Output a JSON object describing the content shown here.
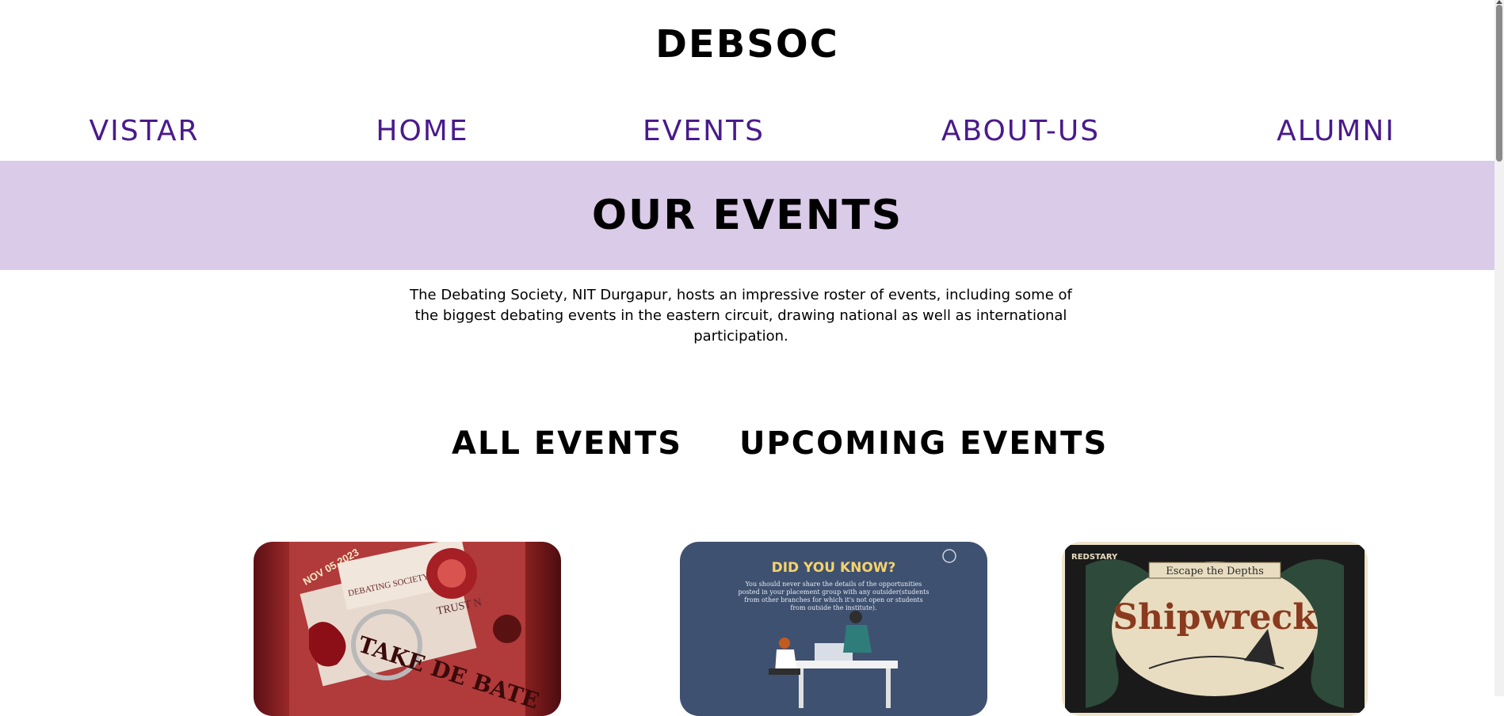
{
  "site": {
    "logo": "DEBSOC"
  },
  "nav": {
    "items": [
      {
        "label": "VISTAR"
      },
      {
        "label": "HOME"
      },
      {
        "label": "EVENTS"
      },
      {
        "label": "ABOUT-US"
      },
      {
        "label": "ALUMNI"
      }
    ]
  },
  "banner": {
    "title": "OUR EVENTS"
  },
  "intro": {
    "text": "The Debating Society, NIT Durgapur, hosts an impressive roster of events, including some of the biggest debating events in the eastern circuit, drawing national as well as international participation."
  },
  "filters": {
    "all": "ALL EVENTS",
    "upcoming": "UPCOMING EVENTS"
  },
  "cards": [
    {
      "date": "NOV 05,2023",
      "org": "DEBATING SOCIETY",
      "title": "TAKE DE BATE",
      "extra": "TRUST N"
    },
    {
      "heading": "DID YOU KNOW?",
      "lines": [
        "You should never share the details of the opportunities",
        "posted in your placement group with any outsider(students",
        "from other branches for which it's not open or students",
        "from outside the institute)."
      ]
    },
    {
      "badge": "REDSTARY",
      "subtitle": "Escape the Depths",
      "title": "Shipwreck"
    }
  ],
  "colors": {
    "nav": "#4a1a8c",
    "banner": "#dacbe8",
    "card2_bg": "#3f5170",
    "card2_heading": "#f5d36b",
    "card3_title": "#8a3a1e"
  }
}
